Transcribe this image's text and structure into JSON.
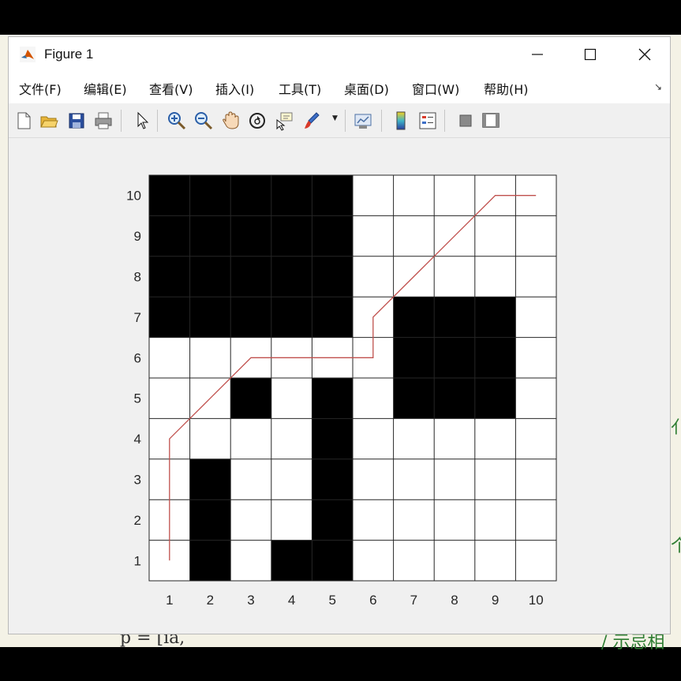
{
  "window": {
    "title": "Figure 1",
    "controls": [
      "minimize",
      "maximize",
      "close"
    ]
  },
  "menubar": {
    "items": [
      "文件(F)",
      "编辑(E)",
      "查看(V)",
      "插入(I)",
      "工具(T)",
      "桌面(D)",
      "窗口(W)",
      "帮助(H)"
    ]
  },
  "toolbar": {
    "icons": [
      "new-figure-icon",
      "open-file-icon",
      "save-icon",
      "print-icon",
      "pointer-icon",
      "zoom-in-icon",
      "zoom-out-icon",
      "pan-icon",
      "rotate-3d-icon",
      "data-cursor-icon",
      "brush-icon",
      "link-plot-icon",
      "colorbar-icon",
      "legend-icon",
      "hide-plot-tools-icon",
      "show-plot-tools-icon"
    ]
  },
  "backdrop": {
    "partial_text": "p = [ia,"
  },
  "chart_data": {
    "type": "heatmap",
    "title": "",
    "xlabel": "",
    "ylabel": "",
    "x_ticks": [
      1,
      2,
      3,
      4,
      5,
      6,
      7,
      8,
      9,
      10
    ],
    "y_ticks": [
      1,
      2,
      3,
      4,
      5,
      6,
      7,
      8,
      9,
      10
    ],
    "xlim": [
      0.5,
      10.5
    ],
    "ylim": [
      0.5,
      10.5
    ],
    "grid": true,
    "cell_colors": {
      "0": "#ffffff",
      "1": "#000000"
    },
    "grid_rows_top_to_bottom": [
      [
        1,
        1,
        1,
        1,
        1,
        0,
        0,
        0,
        0,
        0
      ],
      [
        1,
        1,
        1,
        1,
        1,
        0,
        0,
        0,
        0,
        0
      ],
      [
        1,
        1,
        1,
        1,
        1,
        0,
        0,
        0,
        0,
        0
      ],
      [
        1,
        1,
        1,
        1,
        1,
        0,
        1,
        1,
        1,
        0
      ],
      [
        0,
        0,
        0,
        0,
        0,
        0,
        1,
        1,
        1,
        0
      ],
      [
        0,
        0,
        1,
        0,
        1,
        0,
        1,
        1,
        1,
        0
      ],
      [
        0,
        0,
        0,
        0,
        1,
        0,
        0,
        0,
        0,
        0
      ],
      [
        0,
        1,
        0,
        0,
        1,
        0,
        0,
        0,
        0,
        0
      ],
      [
        0,
        1,
        0,
        0,
        1,
        0,
        0,
        0,
        0,
        0
      ],
      [
        0,
        1,
        0,
        1,
        1,
        0,
        0,
        0,
        0,
        0
      ]
    ],
    "path": {
      "color": "#c0504d",
      "x": [
        1,
        1,
        2,
        3,
        4,
        5,
        6,
        6,
        7,
        8,
        9,
        10
      ],
      "y": [
        1,
        4,
        5,
        6,
        6,
        6,
        6,
        7,
        8,
        9,
        10,
        10
      ]
    }
  }
}
